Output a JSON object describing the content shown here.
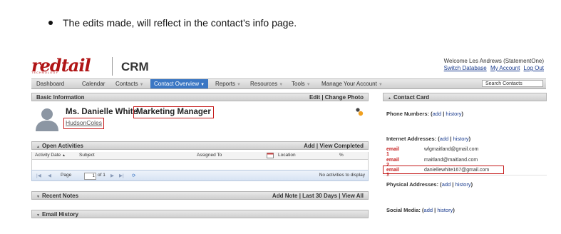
{
  "instruction": "The edits made, will reflect in the contact’s info page.",
  "brand": {
    "logo_text": "redtail",
    "logo_sub": "TECHNOLOGY",
    "product": "CRM"
  },
  "header": {
    "welcome": "Welcome Les Andrews (StatementOne)",
    "switch_db": "Switch Database",
    "my_account": "My Account",
    "logout": "Log Out"
  },
  "nav": {
    "items": [
      "Dashboard",
      "Calendar",
      "Contacts",
      "Contact Overview",
      "Reports",
      "Resources",
      "Tools",
      "Manage Your Account"
    ],
    "active": "Contact Overview",
    "search_placeholder": "Search Contacts"
  },
  "basic_info": {
    "heading": "Basic Information",
    "actions": "Edit | Change Photo",
    "name": "Ms. Danielle White",
    "title": "Marketing Manager",
    "company": "HudsonColes"
  },
  "open_activities": {
    "heading": "Open Activities",
    "actions": "Add | View Completed",
    "columns": [
      "Activity Date",
      "Subject",
      "Assigned To",
      "Location",
      "%"
    ],
    "pager": {
      "page_label": "Page",
      "page_value": "1",
      "of_label": "of 1",
      "status": "No activities to display"
    }
  },
  "recent_notes": {
    "heading": "Recent Notes",
    "actions": "Add Note | Last 30 Days | View All"
  },
  "email_history": {
    "heading": "Email History"
  },
  "contact_card": {
    "heading": "Contact Card",
    "phone_label": "Phone Numbers:",
    "internet_label": "Internet Addresses:",
    "physical_label": "Physical Addresses:",
    "social_label": "Social Media:",
    "add": "add",
    "history": "history",
    "emails": [
      {
        "key": "email 1",
        "value": "wfgmaitland@gmail.com"
      },
      {
        "key": "email 2",
        "value": "maitland@maitland.com"
      },
      {
        "key": "email 3",
        "value": "daniellewhite167@gmail.com"
      }
    ]
  },
  "colors": {
    "brand_red": "#b01516",
    "nav_active": "#3b77c4",
    "highlight": "#c51c1c",
    "link": "#1a3c8f"
  },
  "icons": [
    "user-avatar-icon",
    "organization-icon",
    "calendar-icon",
    "refresh-icon"
  ]
}
